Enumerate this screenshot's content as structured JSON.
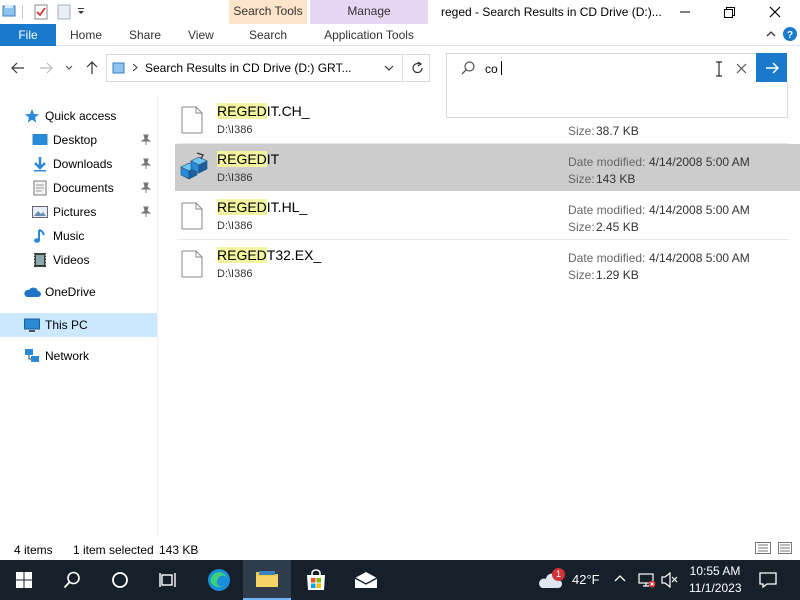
{
  "window": {
    "title": "reged - Search Results in CD Drive (D:)...",
    "context_tabs": {
      "search_tools": "Search Tools",
      "manage": "Manage"
    }
  },
  "ribbon": {
    "tabs": [
      "File",
      "Home",
      "Share",
      "View",
      "Search",
      "Application Tools"
    ]
  },
  "address": {
    "path": "Search Results in CD Drive (D:) GRT..."
  },
  "search": {
    "value": "co",
    "placeholder": ""
  },
  "nav": {
    "quick_access": "Quick access",
    "items": [
      {
        "label": "Desktop",
        "icon": "desktop-icon",
        "pinned": true
      },
      {
        "label": "Downloads",
        "icon": "download-icon",
        "pinned": true
      },
      {
        "label": "Documents",
        "icon": "documents-icon",
        "pinned": true
      },
      {
        "label": "Pictures",
        "icon": "pictures-icon",
        "pinned": true
      },
      {
        "label": "Music",
        "icon": "music-icon",
        "pinned": false
      },
      {
        "label": "Videos",
        "icon": "videos-icon",
        "pinned": false
      }
    ],
    "onedrive": "OneDrive",
    "this_pc": "This PC",
    "network": "Network"
  },
  "files": [
    {
      "name_hl": "REGED",
      "name_rest": "IT.CH_",
      "path": "D:\\I386",
      "date_label": "",
      "date": "",
      "size_label": "Size:",
      "size": "38.7 KB",
      "selected": false,
      "icon": "file-icon"
    },
    {
      "name_hl": "REGED",
      "name_rest": "IT",
      "path": "D:\\I386",
      "date_label": "Date modified:",
      "date": "4/14/2008 5:00 AM",
      "size_label": "Size:",
      "size": "143 KB",
      "selected": true,
      "icon": "regedit-icon"
    },
    {
      "name_hl": "REGED",
      "name_rest": "IT.HL_",
      "path": "D:\\I386",
      "date_label": "Date modified:",
      "date": "4/14/2008 5:00 AM",
      "size_label": "Size:",
      "size": "2.45 KB",
      "selected": false,
      "icon": "file-icon"
    },
    {
      "name_hl": "REGED",
      "name_rest": "T32.EX_",
      "path": "D:\\I386",
      "date_label": "Date modified:",
      "date": "4/14/2008 5:00 AM",
      "size_label": "Size:",
      "size": "1.29 KB",
      "selected": false,
      "icon": "file-icon"
    }
  ],
  "status": {
    "item_count": "4 items",
    "selection": "1 item selected",
    "selection_size": "143 KB"
  },
  "taskbar": {
    "weather_temp": "42°F",
    "weather_badge": "1",
    "time": "10:55 AM",
    "date": "11/1/2023"
  },
  "colors": {
    "accent": "#1979ca",
    "search_tools_tab": "#fbe4c9",
    "manage_tab": "#e8d6f5",
    "selected_row": "#cccccc",
    "nav_selected": "#cce8ff",
    "highlight": "#f4f4a0",
    "taskbar": "#16202b"
  }
}
